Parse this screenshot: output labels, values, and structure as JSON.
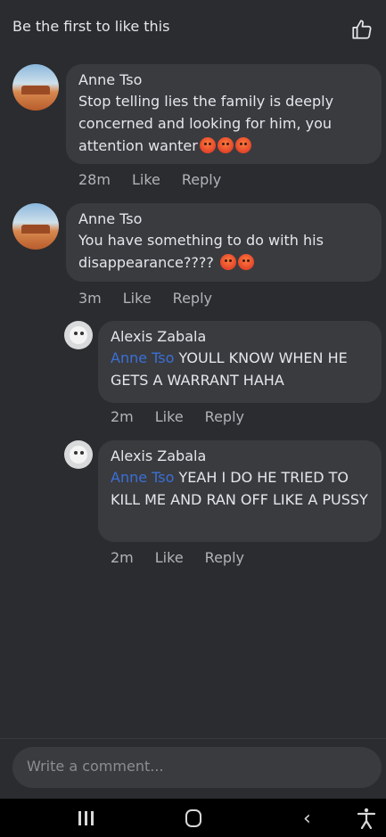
{
  "header": {
    "reactions_text": "Be the first to like this"
  },
  "comments": [
    {
      "author": "Anne Tso",
      "text": "Stop telling lies the family is deeply concerned and looking for him, you attention wanter",
      "time": "28m",
      "like_label": "Like",
      "reply_label": "Reply"
    },
    {
      "author": "Anne Tso",
      "text": "You have something to do with his disappearance????",
      "time": "3m",
      "like_label": "Like",
      "reply_label": "Reply"
    }
  ],
  "replies": [
    {
      "author": "Alexis Zabala",
      "mention": "Anne Tso",
      "text": " YOULL KNOW WHEN HE GETS A WARRANT HAHA",
      "time": "2m",
      "like_label": "Like",
      "reply_label": "Reply"
    },
    {
      "author": "Alexis Zabala",
      "mention": "Anne Tso",
      "text": " YEAH I DO HE TRIED TO KILL ME AND RAN OFF LIKE A PUSSY",
      "time": "2m",
      "like_label": "Like",
      "reply_label": "Reply"
    }
  ],
  "composer": {
    "placeholder": "Write a comment..."
  },
  "colors": {
    "background": "#2b2c2f",
    "bubble": "#3a3b3f",
    "mention": "#3b6fd6",
    "meta": "#b0b3b8"
  },
  "icons": {
    "like": "thumbs-up-icon",
    "reaction": "angry-emoji-icon",
    "nav_recent": "recent-apps-icon",
    "nav_home": "home-icon",
    "nav_back": "back-icon",
    "nav_accessibility": "accessibility-icon"
  }
}
